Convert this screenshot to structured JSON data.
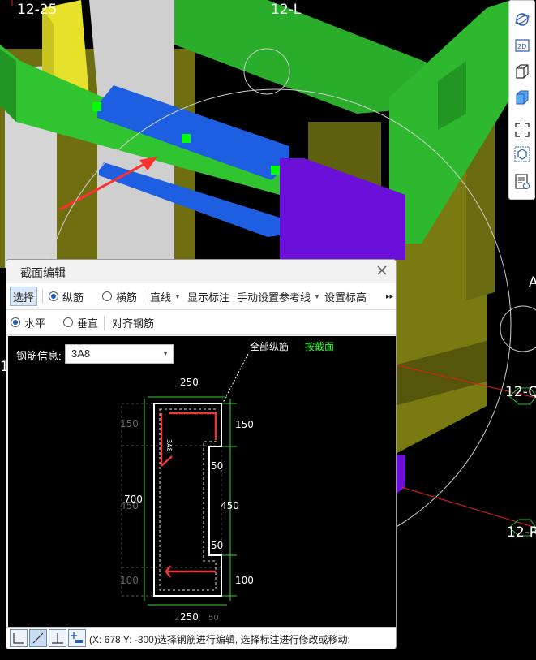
{
  "scene": {
    "axis_labels": [
      "12-25",
      "12-L",
      "12-Q",
      "12-R",
      "1",
      "A"
    ]
  },
  "view_toolbar": {
    "buttons": [
      {
        "icon": "orbit-icon"
      },
      {
        "icon": "2d-view-icon",
        "label": "2D"
      },
      {
        "icon": "3d-box-outline-icon"
      },
      {
        "icon": "3d-box-solid-icon"
      },
      {
        "icon": "fit-view-icon"
      },
      {
        "icon": "cube-display-icon"
      },
      {
        "icon": "properties-icon"
      }
    ]
  },
  "dialog": {
    "title": "截面编辑",
    "toolbar1": {
      "select": "选择",
      "longitudinal": "纵筋",
      "transverse": "横筋",
      "line": "直线",
      "show_dims": "显示标注",
      "manual_ref": "手动设置参考线",
      "set_elevation": "设置标高",
      "more": "▸▸"
    },
    "toolbar2": {
      "horizontal": "水平",
      "vertical": "垂直",
      "align": "对齐钢筋"
    },
    "canvas": {
      "info_label": "钢筋信息:",
      "rebar_value": "3A8",
      "all_long": "全部纵筋",
      "by_section": "按截面",
      "dims": {
        "top_width": "250",
        "bottom_width": "250",
        "left_total": "700",
        "right_150": "150",
        "right_50_top": "50",
        "right_450": "450",
        "right_50_bottom": "50",
        "right_100": "100",
        "ghost_150": "150",
        "ghost_450": "450",
        "ghost_100": "100",
        "ghost_bottom_2": "2",
        "ghost_bottom_50": "50",
        "rebar_text": "3A8"
      }
    },
    "status": {
      "text": "(X: 678 Y: -300)选择钢筋进行编辑, 选择标注进行修改或移动;"
    }
  },
  "colors": {
    "green_beam": "#2db82d",
    "blue_bar": "#1d5fe0",
    "purple": "#6b10d8",
    "olive": "#7a7a10",
    "yellow": "#e4e432",
    "grey_wall": "#c9c9c9",
    "accent_select": "#dbe8f7",
    "section_red": "#e53a3a"
  }
}
